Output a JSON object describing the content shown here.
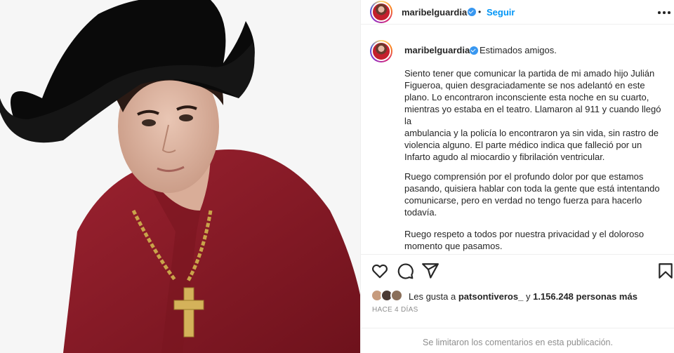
{
  "post": {
    "username": "maribelguardia",
    "follow_label": "Seguir",
    "dot": "•",
    "caption_username": "maribelguardia",
    "greeting": "Estimados amigos.",
    "paragraphs": [
      "Siento tener que comunicar la partida de mi amado hijo Julián Figueroa, quien desgraciadamente se nos adelantó en este plano. Lo encontraron inconsciente esta noche en su cuarto, mientras yo estaba en el teatro. Llamaron al 911 y cuando llegó la\nambulancia y la policía lo encontraron ya sin vida, sin rastro de violencia alguno. El parte médico indica que falleció por un Infarto agudo al miocardio y fibrilación ventricular.",
      "Ruego comprensión por el profundo dolor por que estamos pasando, quisiera hablar con toda la gente que está intentando comunicarse, pero en verdad no tengo fuerza para hacerlo todavía.",
      "Ruego respeto a todos por nuestra privacidad y el doloroso momento que pasamos."
    ],
    "likes_prefix": "Les gusta a",
    "likes_user": "patsontiveros_",
    "likes_and": "y",
    "likes_count": "1.156.248 personas más",
    "time_ago": "HACE 4 DÍAS",
    "comments_limited": "Se limitaron los comentarios en esta publicación."
  },
  "icons": {
    "like": "heart-outline-icon",
    "comment": "speech-bubble-icon",
    "share": "paper-plane-icon",
    "save": "bookmark-icon",
    "more": "more-horizontal-icon",
    "verified": "verified-badge-icon"
  },
  "colors": {
    "accent": "#0095f6",
    "verified": "#3897f0",
    "secondary_text": "#8e8e8e",
    "shirt": "#8d1b26"
  }
}
